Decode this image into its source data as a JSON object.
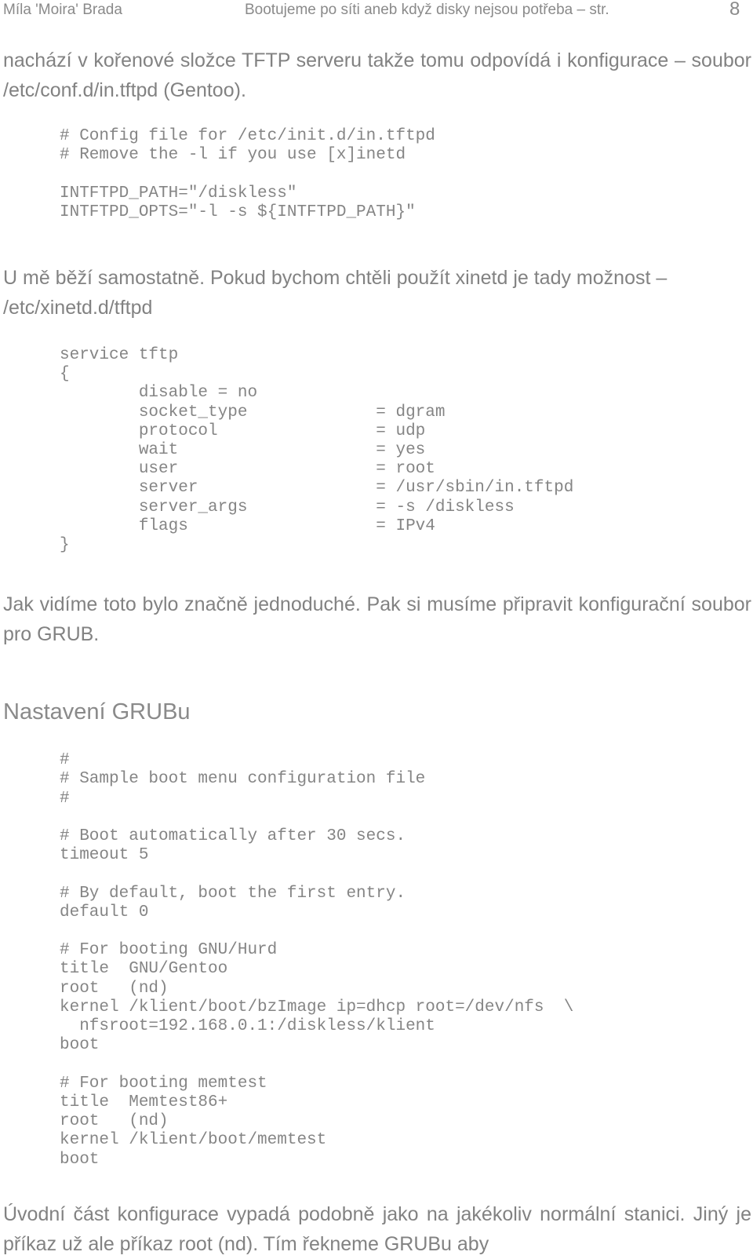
{
  "header": {
    "author": "Míla 'Moira' Brada",
    "title": "Bootujeme po síti aneb když disky nejsou potřeba – str.",
    "page_number": "8"
  },
  "body": {
    "paragraph_1": "nachází v kořenové složce TFTP serveru takže tomu odpovídá i konfigurace – soubor /etc/conf.d/in.tftpd (Gentoo).",
    "code_block_1": "# Config file for /etc/init.d/in.tftpd\n# Remove the -l if you use [x]inetd\n\nINTFTPD_PATH=\"/diskless\"\nINTFTPD_OPTS=\"-l -s ${INTFTPD_PATH}\"",
    "paragraph_2": "U mě běží samostatně. Pokud bychom chtěli použít xinetd je tady možnost – /etc/xinetd.d/tftpd",
    "code_block_2": "service tftp\n{\n        disable = no\n        socket_type             = dgram\n        protocol                = udp\n        wait                    = yes\n        user                    = root\n        server                  = /usr/sbin/in.tftpd\n        server_args             = -s /diskless\n        flags                   = IPv4\n}",
    "paragraph_3": "Jak vidíme toto bylo značně jednoduché. Pak si musíme připravit konfigurační soubor pro GRUB.",
    "heading_1": "Nastavení GRUBu",
    "code_block_3": "#\n# Sample boot menu configuration file\n#\n\n# Boot automatically after 30 secs.\ntimeout 5\n\n# By default, boot the first entry.\ndefault 0\n\n# For booting GNU/Hurd\ntitle  GNU/Gentoo\nroot   (nd)\nkernel /klient/boot/bzImage ip=dhcp root=/dev/nfs  \\\n  nfsroot=192.168.0.1:/diskless/klient\nboot\n\n# For booting memtest\ntitle  Memtest86+\nroot   (nd)\nkernel /klient/boot/memtest\nboot",
    "paragraph_4": "Úvodní část konfigurace vypadá podobně jako na jakékoliv normální stanici. Jiný je příkaz už ale příkaz root (nd). Tím řekneme GRUBu aby"
  },
  "colors": {
    "text": "#828282",
    "code": "#858585",
    "header": "#8a8a8a",
    "background": "#ffffff"
  }
}
